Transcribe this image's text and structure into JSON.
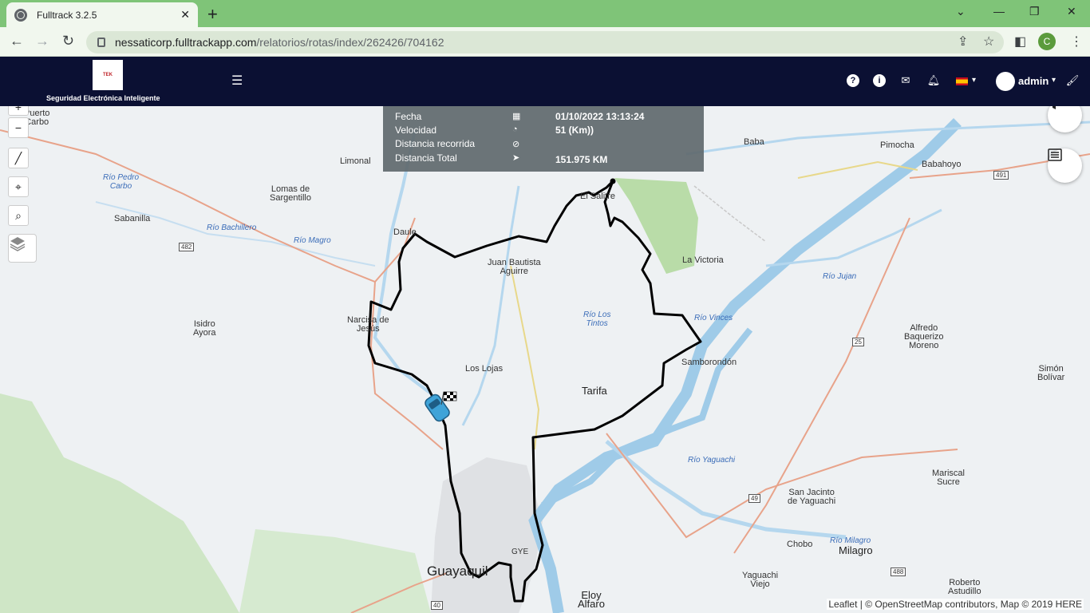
{
  "browser": {
    "tab_title": "Fulltrack 3.2.5",
    "url_host": "nessaticorp.fulltrackapp.com",
    "url_path": "/relatorios/rotas/index/262426/704162",
    "profile_initial": "C"
  },
  "header": {
    "tagline": "Seguridad Electrónica Inteligente",
    "user": "admin"
  },
  "info": {
    "rows": [
      {
        "label": "Fecha",
        "icon": "calendar-icon",
        "value": "01/10/2022 13:13:24"
      },
      {
        "label": "Velocidad",
        "icon": "speedometer-icon",
        "value": "51 (Km))"
      },
      {
        "label": "Distancia recorrida",
        "icon": "compass-icon",
        "value": ""
      },
      {
        "label": "Distancia Total",
        "icon": "location-arrow-icon",
        "value": "151.975 KM"
      }
    ]
  },
  "map": {
    "places": [
      {
        "name": "Puerto\nCarbo"
      },
      {
        "name": "Limonal"
      },
      {
        "name": "Lomas de\nSargentillo"
      },
      {
        "name": "Sabanilla"
      },
      {
        "name": "Daule"
      },
      {
        "name": "Juan Bautista\nAguirre"
      },
      {
        "name": "El Salitre"
      },
      {
        "name": "La Victoria"
      },
      {
        "name": "Baba"
      },
      {
        "name": "Pimocha"
      },
      {
        "name": "Babahoyo"
      },
      {
        "name": "Narcisa de\nJesús"
      },
      {
        "name": "Isidro\nAyora"
      },
      {
        "name": "Los Lojas"
      },
      {
        "name": "Tarifa"
      },
      {
        "name": "Samborondón"
      },
      {
        "name": "Alfredo\nBaquerizo\nMoreno"
      },
      {
        "name": "Simón\nBolívar"
      },
      {
        "name": "Mariscal\nSucre"
      },
      {
        "name": "San Jacinto\nde Yaguachi"
      },
      {
        "name": "Chobo"
      },
      {
        "name": "Milagro"
      },
      {
        "name": "Yaguachi\nViejo"
      },
      {
        "name": "Roberto\nAstudillo"
      },
      {
        "name": "Guayaquil"
      },
      {
        "name": "GYE"
      },
      {
        "name": "Eloy\nAlfaro"
      }
    ],
    "rivers": [
      "Río Pedro\nCarbo",
      "Río Bachillero",
      "Río Magro",
      "Río Los\nTintos",
      "Río Vinces",
      "Río Jujan",
      "Río Yaguachi",
      "Río Milagro"
    ],
    "shields": [
      "482",
      "491",
      "25",
      "49",
      "488",
      "40"
    ],
    "attribution": "Leaflet | © OpenStreetMap contributors, Map © 2019 HERE"
  },
  "colors": {
    "header_bg": "#0b1033",
    "tabbar_bg": "#7fc478",
    "route": "#000000",
    "water": "#9fcbe8"
  }
}
